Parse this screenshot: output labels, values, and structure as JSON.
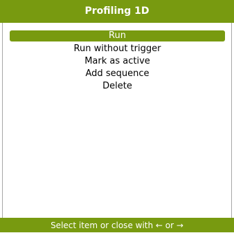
{
  "title": "Profiling 1D",
  "menu": {
    "items": [
      {
        "label": "Run",
        "selected": true
      },
      {
        "label": "Run without trigger",
        "selected": false
      },
      {
        "label": "Mark as active",
        "selected": false
      },
      {
        "label": "Add sequence",
        "selected": false
      },
      {
        "label": "Delete",
        "selected": false
      }
    ]
  },
  "footer": {
    "hint": "Select item or close with ← or →"
  },
  "colors": {
    "accent": "#789a10",
    "border": "#a6a6a6",
    "background": "#ffffff"
  }
}
